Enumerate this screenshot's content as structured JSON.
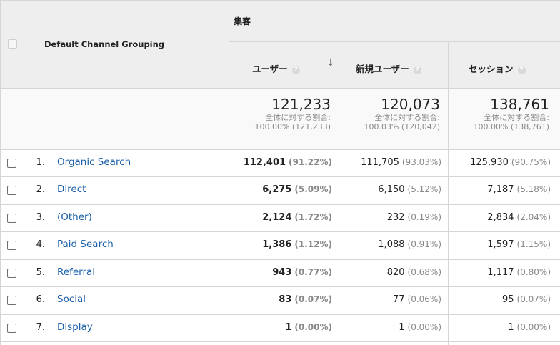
{
  "header": {
    "dimension_title": "Default Channel Grouping",
    "group_title": "集客",
    "columns": [
      {
        "label": "ユーザー",
        "help": "?",
        "sort_icon": "arrow-down-icon",
        "sorted": true
      },
      {
        "label": "新規ユーザー",
        "help": "?"
      },
      {
        "label": "セッション",
        "help": "?"
      }
    ]
  },
  "totals": [
    {
      "value": "121,233",
      "caption": "全体に対する割合:",
      "detail": "100.00% (121,233)"
    },
    {
      "value": "120,073",
      "caption": "全体に対する割合:",
      "detail": "100.03% (120,042)"
    },
    {
      "value": "138,761",
      "caption": "全体に対する割合:",
      "detail": "100.00% (138,761)"
    }
  ],
  "rows": [
    {
      "rank": "1.",
      "label": "Organic Search",
      "users": "112,401",
      "users_pct": "(91.22%)",
      "new_users": "111,705",
      "new_users_pct": "(93.03%)",
      "sessions": "125,930",
      "sessions_pct": "(90.75%)"
    },
    {
      "rank": "2.",
      "label": "Direct",
      "users": "6,275",
      "users_pct": "(5.09%)",
      "new_users": "6,150",
      "new_users_pct": "(5.12%)",
      "sessions": "7,187",
      "sessions_pct": "(5.18%)"
    },
    {
      "rank": "3.",
      "label": "(Other)",
      "users": "2,124",
      "users_pct": "(1.72%)",
      "new_users": "232",
      "new_users_pct": "(0.19%)",
      "sessions": "2,834",
      "sessions_pct": "(2.04%)"
    },
    {
      "rank": "4.",
      "label": "Paid Search",
      "users": "1,386",
      "users_pct": "(1.12%)",
      "new_users": "1,088",
      "new_users_pct": "(0.91%)",
      "sessions": "1,597",
      "sessions_pct": "(1.15%)"
    },
    {
      "rank": "5.",
      "label": "Referral",
      "users": "943",
      "users_pct": "(0.77%)",
      "new_users": "820",
      "new_users_pct": "(0.68%)",
      "sessions": "1,117",
      "sessions_pct": "(0.80%)"
    },
    {
      "rank": "6.",
      "label": "Social",
      "users": "83",
      "users_pct": "(0.07%)",
      "new_users": "77",
      "new_users_pct": "(0.06%)",
      "sessions": "95",
      "sessions_pct": "(0.07%)"
    },
    {
      "rank": "7.",
      "label": "Display",
      "users": "1",
      "users_pct": "(0.00%)",
      "new_users": "1",
      "new_users_pct": "(0.00%)",
      "sessions": "1",
      "sessions_pct": "(0.00%)"
    }
  ],
  "colors": {
    "link": "#1a5fa8",
    "header_bg": "#eeeeee",
    "totals_bg": "#f9f9f9"
  }
}
